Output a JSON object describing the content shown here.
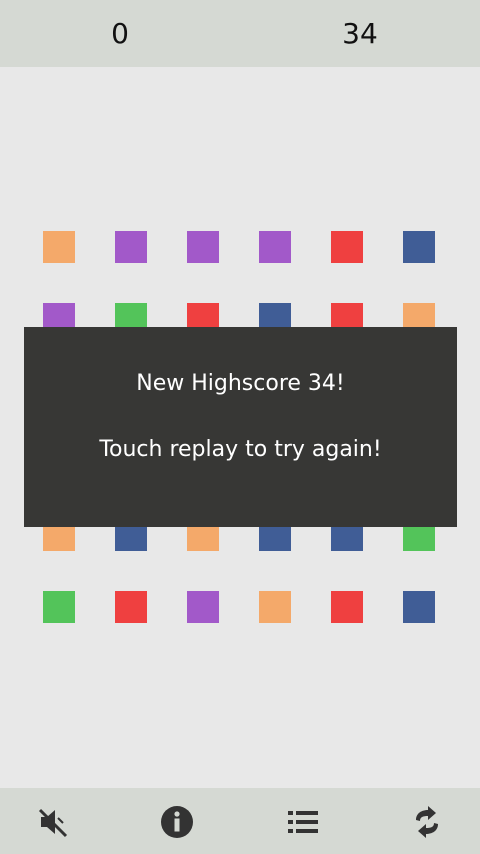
{
  "header": {
    "current_score": "0",
    "high_score": "34"
  },
  "colors": {
    "orange": "#f4a96a",
    "purple": "#a259c9",
    "red": "#ef4040",
    "blue": "#405d96",
    "green": "#53c45a",
    "overlay_bg": "#373735",
    "bar_bg": "#d5d9d3",
    "board_bg": "#e8e8e8"
  },
  "board": {
    "rows": [
      [
        "orange",
        "purple",
        "purple",
        "purple",
        "red",
        "blue"
      ],
      [
        "purple",
        "green",
        "red",
        "blue",
        "red",
        "orange"
      ],
      [
        null,
        null,
        null,
        null,
        null,
        null
      ],
      [
        null,
        null,
        null,
        null,
        null,
        null
      ],
      [
        "orange",
        "blue",
        "orange",
        "blue",
        "blue",
        "green"
      ],
      [
        "green",
        "red",
        "purple",
        "orange",
        "red",
        "blue"
      ]
    ]
  },
  "dialog": {
    "line1": "New Highscore 34!",
    "line2": "Touch replay to try again!"
  },
  "toolbar": {
    "icons": [
      "mute-icon",
      "info-icon",
      "list-icon",
      "replay-icon"
    ]
  }
}
